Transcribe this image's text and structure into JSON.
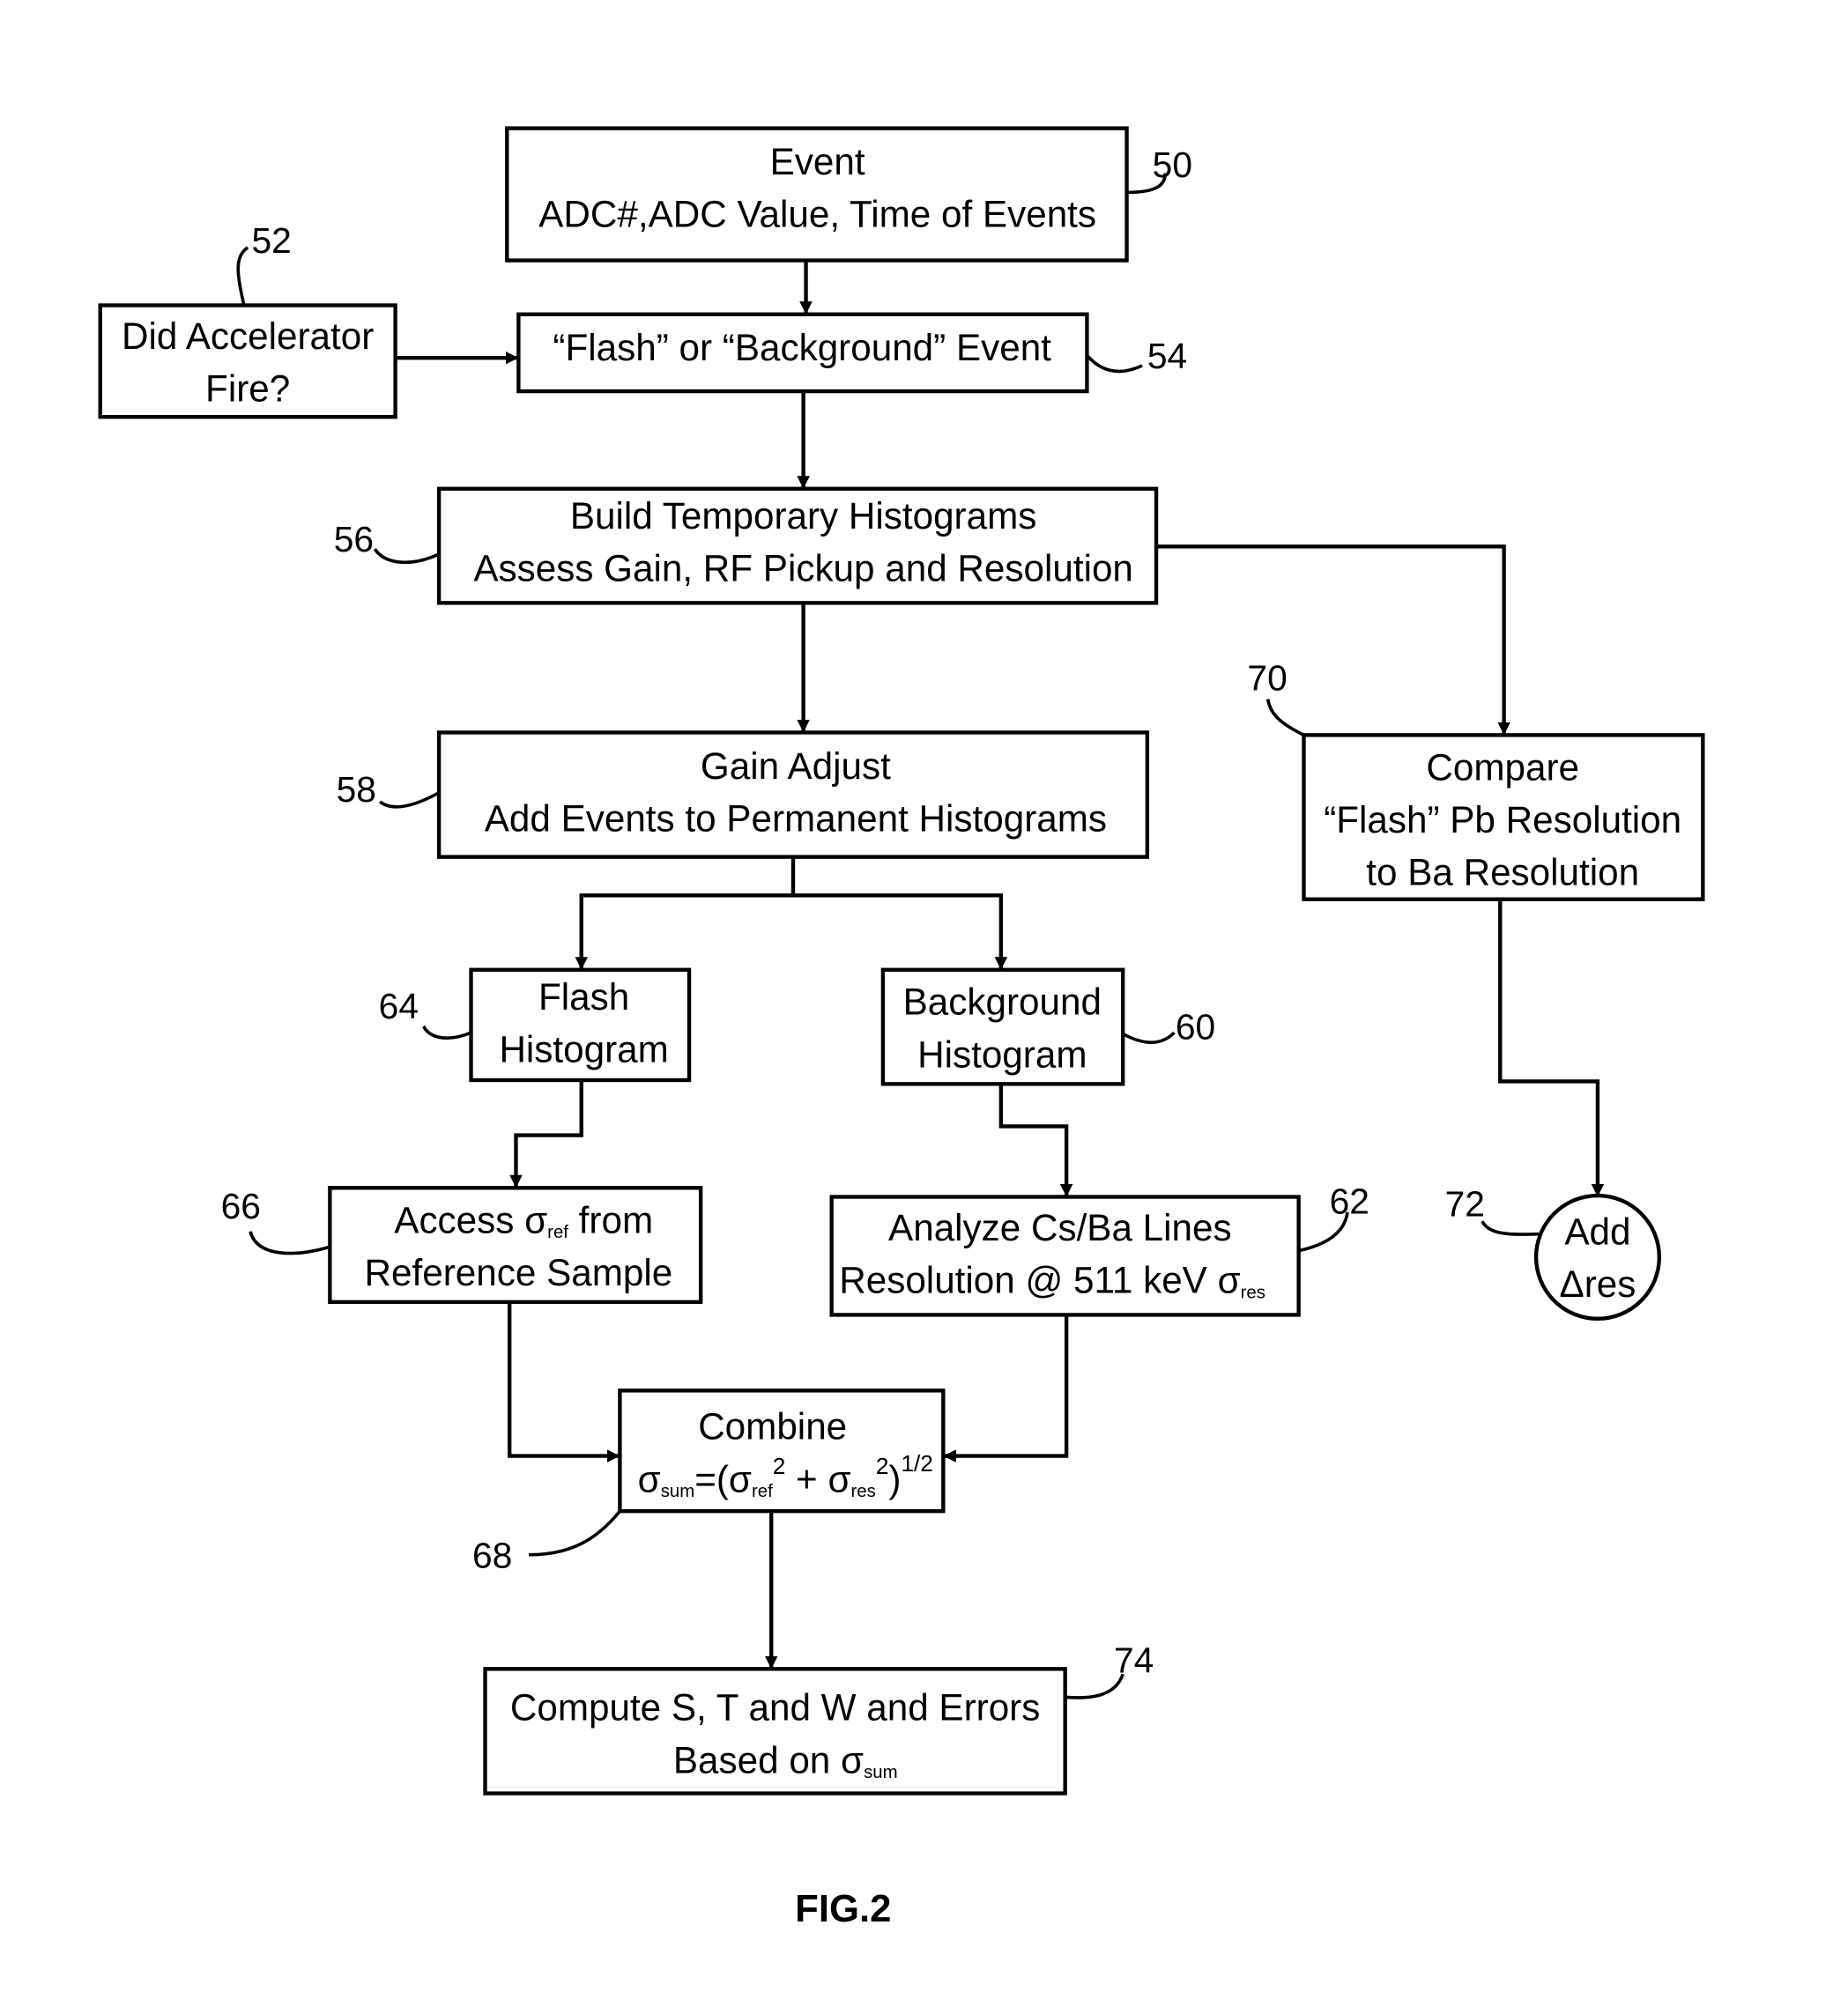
{
  "figure_label": "FIG.2",
  "nodes": {
    "n50": {
      "ref": "50",
      "line1": "Event",
      "line2": "ADC#,ADC Value, Time of Events"
    },
    "n52": {
      "ref": "52",
      "line1": "Did Accelerator",
      "line2": "Fire?"
    },
    "n54": {
      "ref": "54",
      "line1": "“Flash” or “Background” Event"
    },
    "n56": {
      "ref": "56",
      "line1": "Build Temporary Histograms",
      "line2": "Assess Gain, RF Pickup and Resolution"
    },
    "n58": {
      "ref": "58",
      "line1": "Gain Adjust",
      "line2": "Add Events to Permanent Histograms"
    },
    "n64": {
      "ref": "64",
      "line1": "Flash",
      "line2": "Histogram"
    },
    "n60": {
      "ref": "60",
      "line1": "Background",
      "line2": "Histogram"
    },
    "n66": {
      "ref": "66",
      "line1a": "Access σ",
      "line1sub": "ref",
      "line1b": " from",
      "line2": "Reference Sample"
    },
    "n62": {
      "ref": "62",
      "line1": "Analyze Cs/Ba Lines",
      "line2a": "Resolution @ 511 keV σ",
      "line2sub": "res"
    },
    "n68": {
      "ref": "68",
      "line1": "Combine",
      "f_sigma": "σ",
      "f_sum": "sum",
      "f_eq": "=(σ",
      "f_ref": "ref",
      "f_sq1": "2",
      "f_plus": " + σ",
      "f_res": "res",
      "f_sq2": "2",
      "f_close": ")",
      "f_exp": "1/2"
    },
    "n70": {
      "ref": "70",
      "line1": "Compare",
      "line2": "“Flash” Pb Resolution",
      "line3": "to Ba Resolution"
    },
    "n72": {
      "ref": "72",
      "line1": "Add",
      "line2": "Δres"
    },
    "n74": {
      "ref": "74",
      "line1": "Compute S, T and W and Errors",
      "line2a": "Based on σ",
      "line2sub": "sum"
    }
  }
}
